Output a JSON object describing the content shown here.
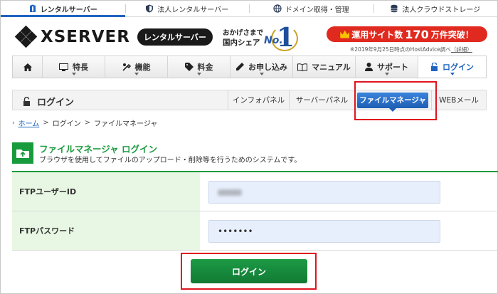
{
  "service_tabs": [
    {
      "label": "レンタルサーバー",
      "icon": "building-icon",
      "active": true
    },
    {
      "label": "法人レンタルサーバー",
      "icon": "shield-icon",
      "active": false
    },
    {
      "label": "ドメイン取得・管理",
      "icon": "globe-icon",
      "active": false
    },
    {
      "label": "法人クラウドストレージ",
      "icon": "database-icon",
      "active": false
    }
  ],
  "header": {
    "logo_text": "XSERVER",
    "logo_badge": "レンタルサーバー",
    "no1_line1": "おかげさまで",
    "no1_line2": "国内シェア",
    "no1_no": "No.",
    "no1_num": "1",
    "promo_prefix": "運用サイト数",
    "promo_number": "170",
    "promo_suffix": "万件突破！",
    "promo_note": "※2019年9月25日時点のHostAdvice調べ",
    "promo_note_link": "（詳細）",
    "brand_color": "#1a1a1a",
    "promo_color": "#e12a1f"
  },
  "main_nav": [
    {
      "label": "",
      "icon": "home-icon"
    },
    {
      "label": "特長",
      "icon": "monitor-icon"
    },
    {
      "label": "機能",
      "icon": "tools-icon"
    },
    {
      "label": "料金",
      "icon": "tag-icon"
    },
    {
      "label": "お申し込み",
      "icon": "pen-icon"
    },
    {
      "label": "マニュアル",
      "icon": "book-icon"
    },
    {
      "label": "サポート",
      "icon": "person-icon"
    },
    {
      "label": "ログイン",
      "icon": "unlock-icon",
      "active": true
    }
  ],
  "subbar": {
    "title": "ログイン",
    "tabs": [
      {
        "label": "インフォパネル",
        "active": false
      },
      {
        "label": "サーバーパネル",
        "active": false
      },
      {
        "label": "ファイルマネージャ",
        "active": true
      },
      {
        "label": "WEBメール",
        "active": false
      }
    ]
  },
  "breadcrumb": {
    "home": "ホーム",
    "sep": ">",
    "level2": "ログイン",
    "current": "ファイルマネージャ"
  },
  "section": {
    "title": "ファイルマネージャ ログイン",
    "description": "ブラウザを使用してファイルのアップロード・削除等を行うためのシステムです。",
    "accent_color": "#189b3c"
  },
  "form": {
    "id_label": "FTPユーザーID",
    "id_value": "",
    "password_label": "FTPパスワード",
    "password_value": "•••••••",
    "submit_label": "ログイン"
  }
}
